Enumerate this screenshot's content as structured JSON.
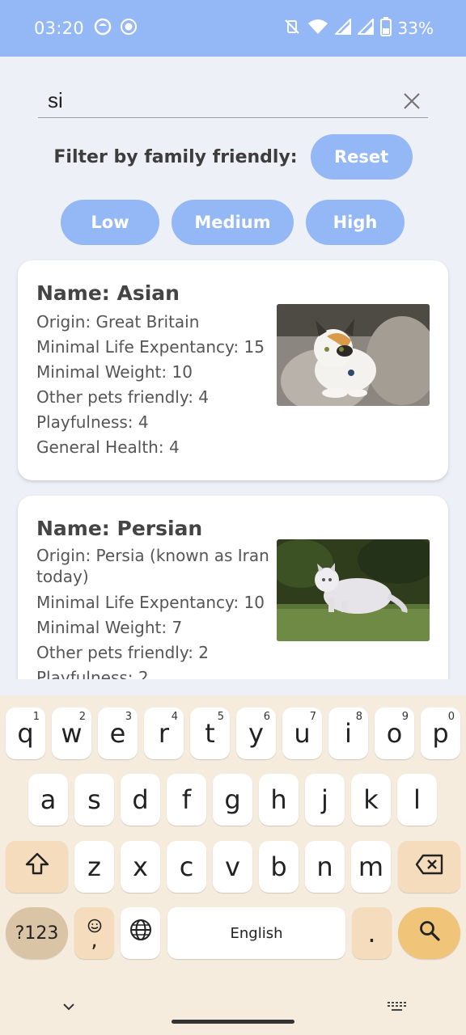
{
  "status_bar": {
    "time": "03:20",
    "battery": "33%"
  },
  "search": {
    "value": "si"
  },
  "filter": {
    "label": "Filter by family friendly:",
    "reset_label": "Reset",
    "levels": [
      "Low",
      "Medium",
      "High"
    ]
  },
  "cards": [
    {
      "name": "Name: Asian",
      "origin": "Origin: Great Britain",
      "life": "Minimal Life Expentancy: 15",
      "weight": "Minimal Weight: 10",
      "pets": "Other pets friendly: 4",
      "play": "Playfulness: 4",
      "health": "General Health: 4"
    },
    {
      "name": "Name: Persian",
      "origin": "Origin: Persia (known as Iran today)",
      "life": "Minimal Life Expentancy: 10",
      "weight": "Minimal Weight: 7",
      "pets": "Other pets friendly: 2",
      "play": "Playfulness: 2"
    }
  ],
  "keyboard": {
    "row1": [
      "q",
      "w",
      "e",
      "r",
      "t",
      "y",
      "u",
      "i",
      "o",
      "p"
    ],
    "row1_hints": [
      "1",
      "2",
      "3",
      "4",
      "5",
      "6",
      "7",
      "8",
      "9",
      "0"
    ],
    "row2": [
      "a",
      "s",
      "d",
      "f",
      "g",
      "h",
      "j",
      "k",
      "l"
    ],
    "row3": [
      "z",
      "x",
      "c",
      "v",
      "b",
      "n",
      "m"
    ],
    "sym_label": "?123",
    "emoji_comma": ",",
    "space_label": "English",
    "period": "."
  }
}
